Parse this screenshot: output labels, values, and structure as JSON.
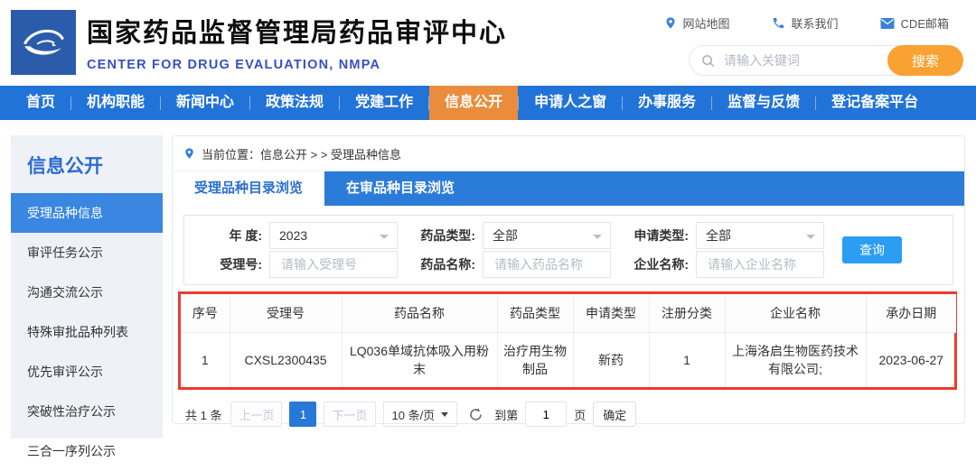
{
  "header": {
    "title_cn": "国家药品监督管理局药品审评中心",
    "title_en": "CENTER FOR DRUG EVALUATION, NMPA",
    "links": [
      {
        "icon": "map-pin-icon",
        "label": "网站地图"
      },
      {
        "icon": "phone-icon",
        "label": "联系我们"
      },
      {
        "icon": "mail-icon",
        "label": "CDE邮箱"
      }
    ],
    "search": {
      "placeholder": "请输入关键词",
      "button": "搜索"
    }
  },
  "nav": {
    "items": [
      {
        "label": "首页",
        "active": false
      },
      {
        "label": "机构职能",
        "active": false
      },
      {
        "label": "新闻中心",
        "active": false
      },
      {
        "label": "政策法规",
        "active": false
      },
      {
        "label": "党建工作",
        "active": false
      },
      {
        "label": "信息公开",
        "active": true
      },
      {
        "label": "申请人之窗",
        "active": false
      },
      {
        "label": "办事服务",
        "active": false
      },
      {
        "label": "监督与反馈",
        "active": false
      },
      {
        "label": "登记备案平台",
        "active": false
      }
    ]
  },
  "sidebar": {
    "title": "信息公开",
    "items": [
      {
        "label": "受理品种信息",
        "active": true
      },
      {
        "label": "审评任务公示",
        "active": false
      },
      {
        "label": "沟通交流公示",
        "active": false
      },
      {
        "label": "特殊审批品种列表",
        "active": false
      },
      {
        "label": "优先审评公示",
        "active": false
      },
      {
        "label": "突破性治疗公示",
        "active": false
      },
      {
        "label": "三合一序列公示",
        "active": false
      }
    ]
  },
  "breadcrumb": {
    "text": "当前位置：信息公开 > > 受理品种信息"
  },
  "tabs": [
    {
      "label": "受理品种目录浏览",
      "active": true
    },
    {
      "label": "在审品种目录浏览",
      "active": false
    }
  ],
  "filters": {
    "fields": [
      {
        "label": "年 度:",
        "type": "select",
        "value": "2023"
      },
      {
        "label": "药品类型:",
        "type": "select",
        "value": "全部"
      },
      {
        "label": "申请类型:",
        "type": "select",
        "value": "全部"
      },
      {
        "label": "受理号:",
        "type": "input",
        "placeholder": "请输入受理号"
      },
      {
        "label": "药品名称:",
        "type": "input",
        "placeholder": "请输入药品名称"
      },
      {
        "label": "企业名称:",
        "type": "input",
        "placeholder": "请输入企业名称"
      }
    ],
    "query_button": "查询"
  },
  "table": {
    "headers": [
      "序号",
      "受理号",
      "药品名称",
      "药品类型",
      "申请类型",
      "注册分类",
      "企业名称",
      "承办日期"
    ],
    "rows": [
      [
        "1",
        "CXSL2300435",
        "LQ036单域抗体吸入用粉末",
        "治疗用生物制品",
        "新药",
        "1",
        "上海洛启生物医药技术有限公司;",
        "2023-06-27"
      ]
    ]
  },
  "pagination": {
    "total": "共 1 条",
    "prev": "上一页",
    "page": "1",
    "next": "下一页",
    "page_size": "10 条/页",
    "goto_prefix": "到第",
    "goto_value": "1",
    "goto_suffix": "页",
    "confirm": "确定"
  },
  "colors": {
    "nav_blue": "#2173d8",
    "nav_active_orange": "#ea8c3c",
    "search_button_orange": "#f9a233",
    "tab_strip_blue": "#2b7cd9",
    "sidebar_bg": "#eef1f6",
    "sidebar_active_blue": "#3987e0",
    "title_en_blue": "#3a4fc4",
    "link_icon_blue": "#3b82d6",
    "query_button_blue": "#2b9df3",
    "page_active_blue": "#2878d7",
    "highlight_red": "#f0392e"
  }
}
